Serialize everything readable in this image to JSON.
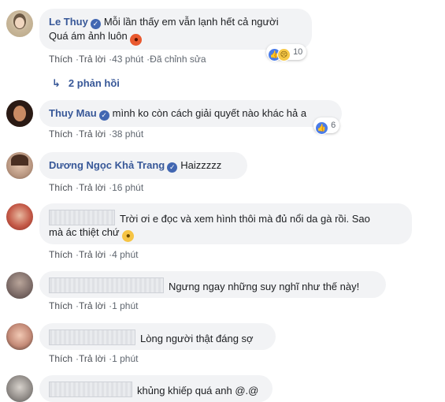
{
  "actions": {
    "like": "Thích",
    "reply": "Trả lời",
    "separator": "·"
  },
  "comments": [
    {
      "author": "Le Thuy",
      "verified": true,
      "line1": "Mỗi lần thấy em vẫn lạnh hết cả người",
      "line2": "Quá ám ảnh luôn",
      "emoji": "angry-face",
      "time": "43 phút",
      "edited": "Đã chỉnh sửa",
      "reaction_count": "10",
      "reactions": [
        "like",
        "sad"
      ]
    },
    {
      "author": "Thuy Mau",
      "verified": true,
      "text": "mình ko còn cách giải quyết nào khác hả a",
      "time": "38 phút",
      "reaction_count": "6",
      "reactions": [
        "like"
      ]
    },
    {
      "author": "Dương Ngọc Khả Trang",
      "verified": true,
      "text": "Haizzzzz",
      "time": "16 phút"
    },
    {
      "author_redacted": true,
      "line1": "Trời ơi e đọc và xem hình thôi mà đủ nổi da gà rồi. Sao",
      "line2": "mà ác thiệt chứ",
      "emoji": "sad-face",
      "time": "4 phút"
    },
    {
      "author_redacted": true,
      "text": "Ngưng ngay những suy nghĩ như thế này!",
      "time": "1 phút"
    },
    {
      "author_redacted": true,
      "text": "Lòng người thật đáng sợ",
      "time": "1 phút"
    },
    {
      "author_redacted": true,
      "text": "khủng khiếp quá anh @.@"
    }
  ],
  "replies_link": "2 phản hồi"
}
